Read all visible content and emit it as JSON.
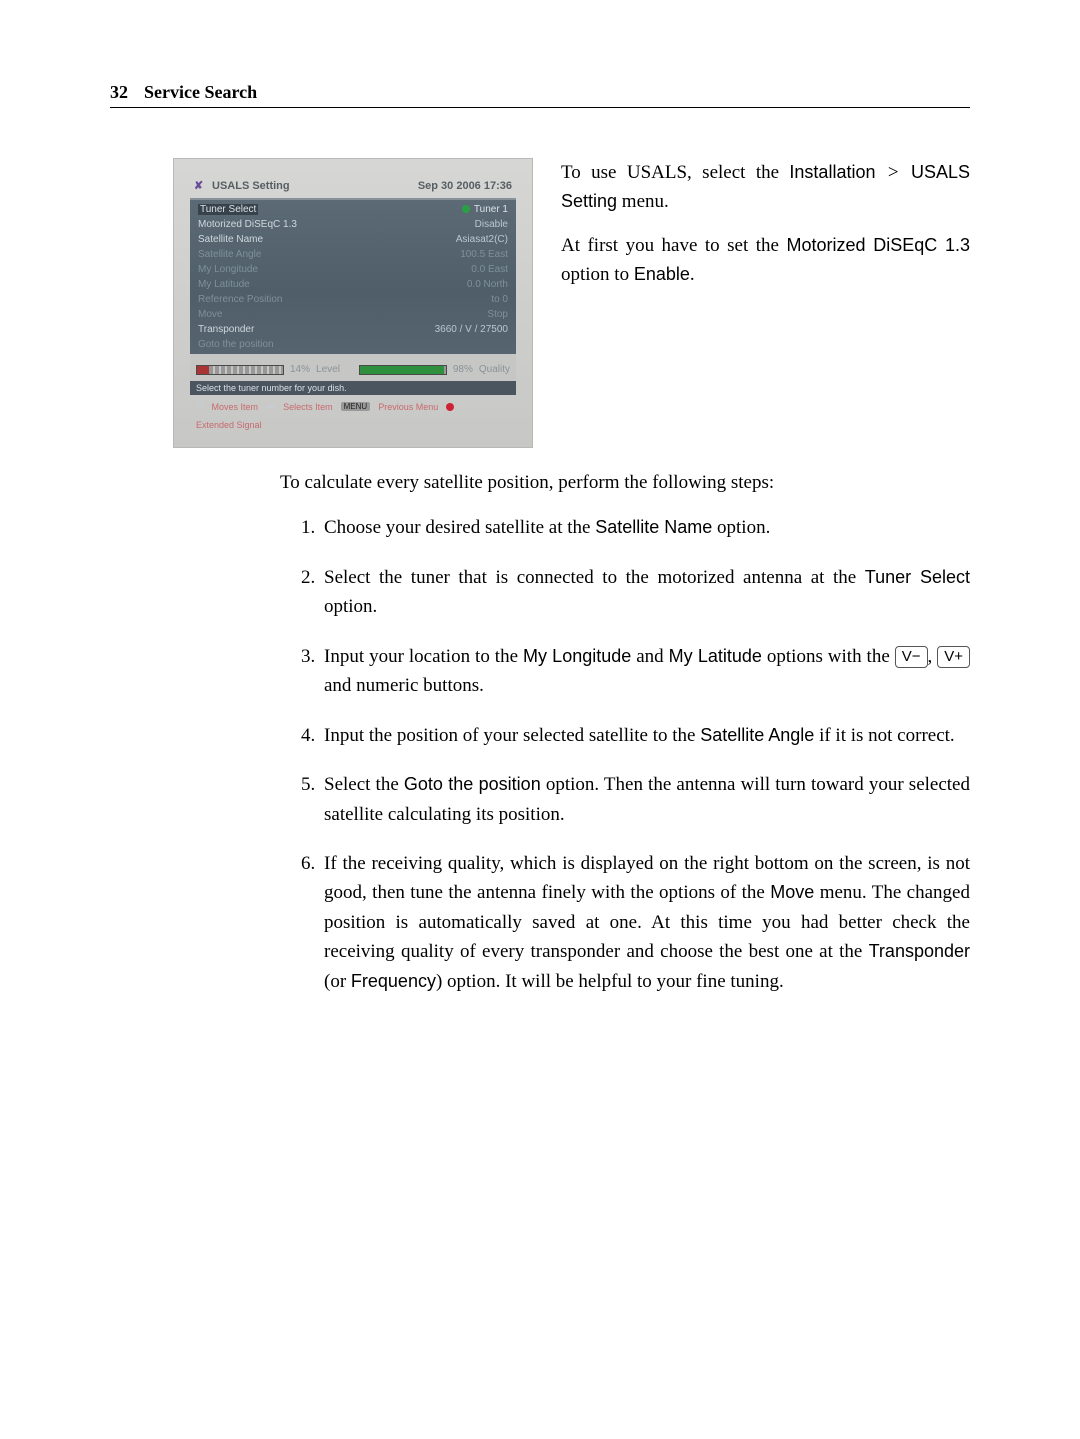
{
  "header": {
    "page_number": "32",
    "chapter_title": "Service Search"
  },
  "screenshot": {
    "title": "USALS Setting",
    "datetime": "Sep 30 2006 17:36",
    "rows": [
      {
        "label": "Tuner Select",
        "value": "Tuner 1",
        "selected": true,
        "indicator": true
      },
      {
        "label": "Motorized DiSEqC 1.3",
        "value": "Disable"
      },
      {
        "label": "Satellite Name",
        "value": "Asiasat2(C)"
      },
      {
        "label": "Satellite Angle",
        "value": "100.5 East",
        "dim": true
      },
      {
        "label": "My Longitude",
        "value": "0.0 East",
        "dim": true
      },
      {
        "label": "My Latitude",
        "value": "0.0 North",
        "dim": true
      },
      {
        "label": "Reference Position",
        "value": "to 0",
        "dim": true
      },
      {
        "label": "Move",
        "value": "Stop",
        "dim": true
      },
      {
        "label": "Transponder",
        "value": "3660 / V / 27500"
      },
      {
        "label": "Goto the position",
        "value": "",
        "dim": true
      }
    ],
    "signal": {
      "level_percent": "14%",
      "level_label": "Level",
      "quality_percent": "98%",
      "quality_label": "Quality"
    },
    "hint": "Select the tuner number for your dish.",
    "footer": {
      "moves": "Moves Item",
      "selects": "Selects Item",
      "menu_pill": "MENU",
      "prev_menu": "Previous Menu",
      "extended": "Extended Signal"
    }
  },
  "aside": {
    "p1_pre": "To use USALS, select the ",
    "p1_ui1": "Installation",
    "p1_sep": ">",
    "p1_ui2": "USALS Setting",
    "p1_post": " menu.",
    "p2_pre": "At first you have to set the ",
    "p2_ui": "Motorized DiSEqC 1.3",
    "p2_mid": " option to ",
    "p2_ui2": "Enable",
    "p2_post": "."
  },
  "lead": "To calculate every satellite position, perform the following steps:",
  "steps": {
    "s1_pre": "Choose your desired satellite at the ",
    "s1_ui": "Satellite Name",
    "s1_post": " option.",
    "s2_pre": "Select the tuner that is connected to the motorized antenna at the ",
    "s2_ui": "Tuner Select",
    "s2_post": " option.",
    "s3_pre": "Input your location to the ",
    "s3_ui1": "My Longitude",
    "s3_and": " and ",
    "s3_ui2": "My Latitude",
    "s3_mid": " options with the ",
    "s3_key1": "V−",
    "s3_comma": ", ",
    "s3_key2": "V+",
    "s3_post": " and numeric buttons.",
    "s4_pre": "Input the position of your selected satellite to the ",
    "s4_ui": "Satellite Angle",
    "s4_post": " if it is not correct.",
    "s5_pre": "Select the ",
    "s5_ui": "Goto the position",
    "s5_post": " option. Then the antenna will turn toward your selected satellite calculating its position.",
    "s6_pre": "If the receiving quality, which is displayed on the right bottom on the screen, is not good, then tune the antenna finely with the options of the ",
    "s6_ui1": "Move",
    "s6_mid1": " menu. The changed position is automatically saved at one. At this time you had better check the receiving quality of every transponder and choose the best one at the ",
    "s6_ui2": "Transponder",
    "s6_or": " (or ",
    "s6_ui3": "Frequency",
    "s6_post": ") option. It will be helpful to your fine tuning."
  }
}
